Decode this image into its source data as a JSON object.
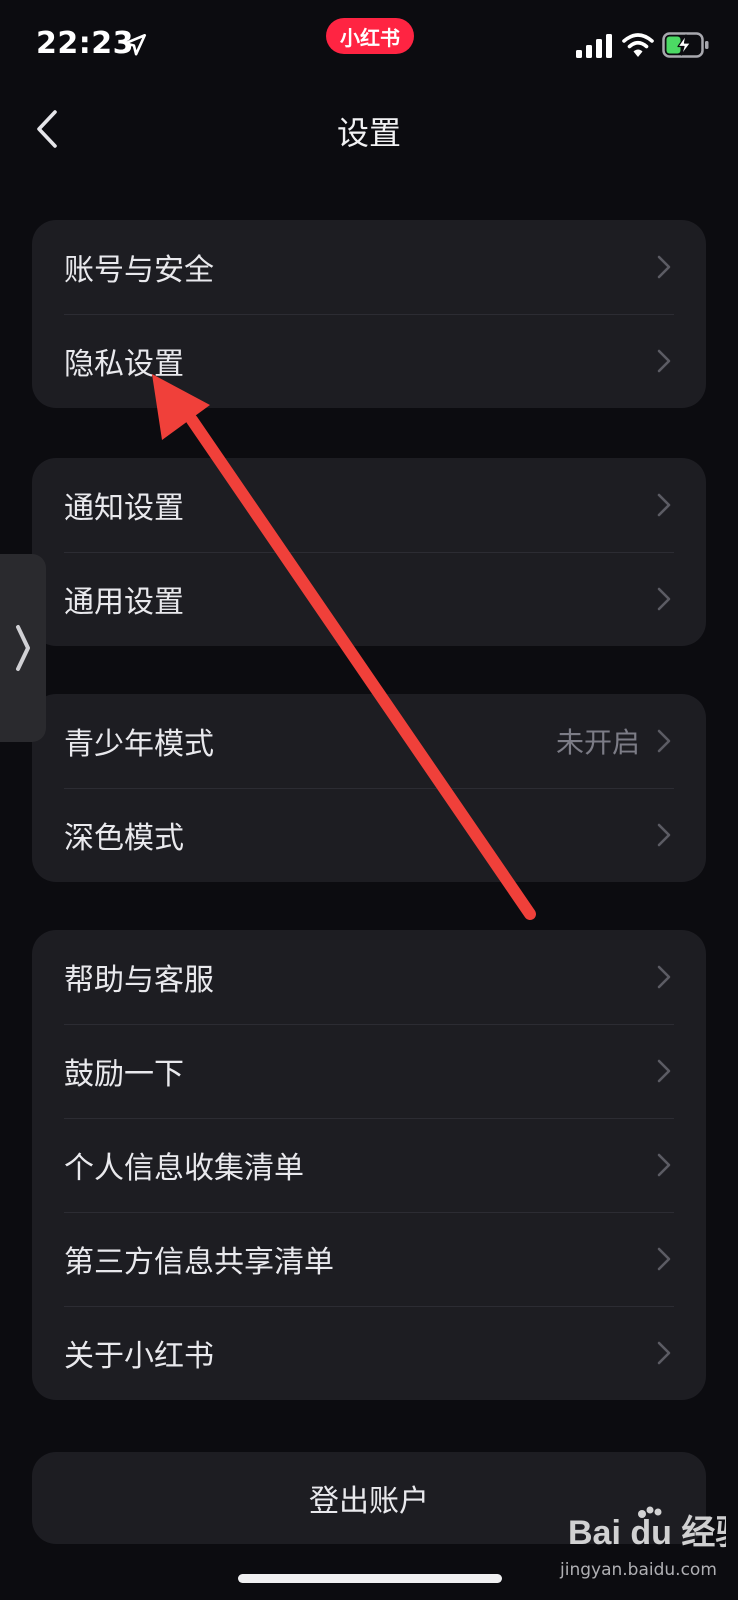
{
  "status_bar": {
    "time": "22:23",
    "app_badge": "小红书"
  },
  "nav": {
    "title": "设置"
  },
  "groups": [
    {
      "items": [
        {
          "label": "账号与安全"
        },
        {
          "label": "隐私设置"
        }
      ]
    },
    {
      "items": [
        {
          "label": "通知设置"
        },
        {
          "label": "通用设置"
        }
      ]
    },
    {
      "items": [
        {
          "label": "青少年模式",
          "value": "未开启"
        },
        {
          "label": "深色模式"
        }
      ]
    },
    {
      "items": [
        {
          "label": "帮助与客服"
        },
        {
          "label": "鼓励一下"
        },
        {
          "label": "个人信息收集清单"
        },
        {
          "label": "第三方信息共享清单"
        },
        {
          "label": "关于小红书"
        }
      ]
    }
  ],
  "logout_label": "登出账户",
  "watermark": {
    "brand": "Bai du 经验",
    "site": "jingyan.baidu.com"
  },
  "colors": {
    "background": "#0c0c10",
    "card": "#1d1d22",
    "brand_red": "#ff2442",
    "annotation_arrow": "#f0403a",
    "battery_green": "#4cd964"
  }
}
